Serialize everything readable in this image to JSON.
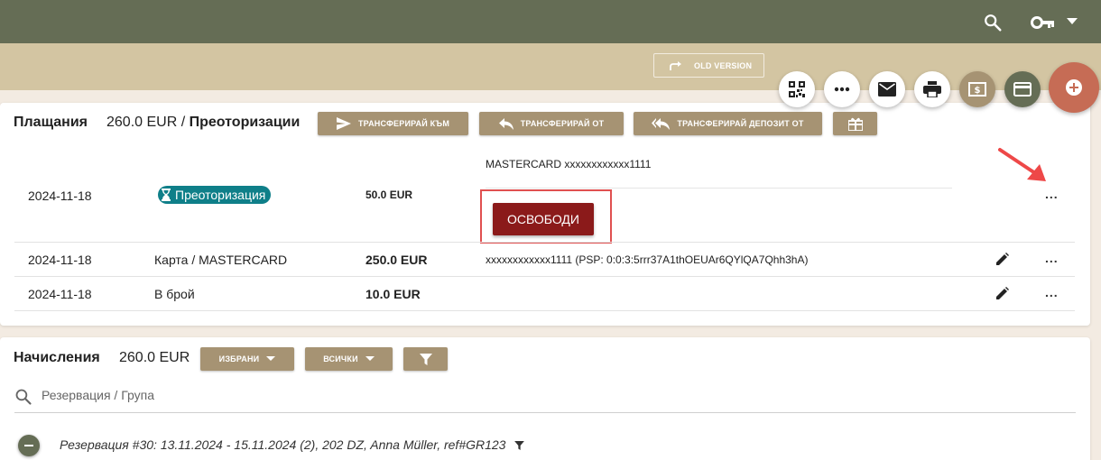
{
  "header": {
    "old_version_label": "OLD VERSION"
  },
  "payments": {
    "title": "Плащания",
    "amount": "260.0 EUR",
    "separator": "/",
    "preauth_title": "Преоторизации",
    "buttons": {
      "transfer_to": "ТРАНСФЕРИРАЙ КЪМ",
      "transfer_from": "ТРАНСФЕРИРАЙ ОТ",
      "transfer_deposit_from": "ТРАНСФЕРИРАЙ ДЕПОЗИТ ОТ"
    },
    "rows": [
      {
        "date": "2024-11-18",
        "type": "Преоторизация",
        "amount": "50.0 EUR",
        "details": "MASTERCARD xxxxxxxxxxxx1111",
        "action": "ОСВОБОДИ",
        "more": "..."
      },
      {
        "date": "2024-11-18",
        "type": "Карта / MASTERCARD",
        "amount": "250.0 EUR",
        "details": "xxxxxxxxxxxx1111 (PSP: 0:0:3:5rrr37A1thOEUAr6QYlQA7Qhh3hA)",
        "more": "..."
      },
      {
        "date": "2024-11-18",
        "type": "В брой",
        "amount": "10.0 EUR",
        "details": "",
        "more": "..."
      }
    ]
  },
  "charges": {
    "title": "Начисления",
    "amount": "260.0 EUR",
    "selected_label": "ИЗБРАНИ",
    "all_label": "ВСИЧКИ",
    "search_placeholder": "Резервация / Група",
    "reservation": "Резервация #30: 13.11.2024 - 15.11.2024 (2), 202 DZ, Anna Müller, ref#GR123"
  },
  "colors": {
    "topbar": "#656d55",
    "subbar": "#d3c5a2",
    "button": "#a69373",
    "badge": "#0f7f89",
    "release": "#8b1a1a",
    "highlight": "#e05050",
    "fab_add": "#c66c55"
  },
  "icons": [
    "search-icon",
    "key-icon",
    "chevron-down-icon",
    "redo-icon",
    "qr-code-icon",
    "more-icon",
    "mail-icon",
    "print-icon",
    "cash-icon",
    "credit-card-icon",
    "add-icon",
    "send-icon",
    "reply-icon",
    "reply-all-icon",
    "gift-icon",
    "hourglass-icon",
    "pencil-icon",
    "filter-icon",
    "minus-icon",
    "arrow-icon"
  ]
}
